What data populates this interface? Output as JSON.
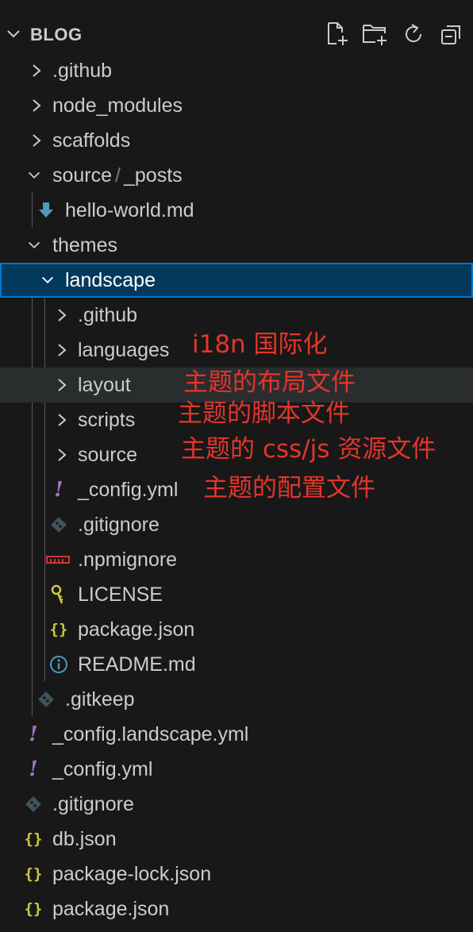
{
  "explorer": {
    "title": "BLOG",
    "actions": [
      {
        "name": "new-file-icon"
      },
      {
        "name": "new-folder-icon"
      },
      {
        "name": "refresh-icon"
      },
      {
        "name": "collapse-all-icon"
      }
    ]
  },
  "tree": [
    {
      "label": ".github",
      "kind": "folder",
      "expanded": false,
      "icon": "chevron-right-icon"
    },
    {
      "label": "node_modules",
      "kind": "folder",
      "expanded": false,
      "icon": "chevron-right-icon"
    },
    {
      "label": "scaffolds",
      "kind": "folder",
      "expanded": false,
      "icon": "chevron-right-icon"
    },
    {
      "label": "source",
      "label_sep": "/",
      "label_tail": "_posts",
      "kind": "folder",
      "expanded": true,
      "icon": "chevron-down-icon"
    },
    {
      "label": "hello-world.md",
      "kind": "file",
      "icon": "markdown-icon"
    },
    {
      "label": "themes",
      "kind": "folder",
      "expanded": true,
      "icon": "chevron-down-icon"
    },
    {
      "label": "landscape",
      "kind": "folder",
      "expanded": true,
      "selected": true,
      "icon": "chevron-down-icon"
    },
    {
      "label": ".github",
      "kind": "folder",
      "expanded": false,
      "icon": "chevron-right-icon"
    },
    {
      "label": "languages",
      "kind": "folder",
      "expanded": false,
      "icon": "chevron-right-icon"
    },
    {
      "label": "layout",
      "kind": "folder",
      "expanded": false,
      "icon": "chevron-right-icon"
    },
    {
      "label": "scripts",
      "kind": "folder",
      "expanded": false,
      "icon": "chevron-right-icon"
    },
    {
      "label": "source",
      "kind": "folder",
      "expanded": false,
      "icon": "chevron-right-icon"
    },
    {
      "label": "_config.yml",
      "kind": "file",
      "icon": "yaml-icon"
    },
    {
      "label": ".gitignore",
      "kind": "file",
      "icon": "git-icon"
    },
    {
      "label": ".npmignore",
      "kind": "file",
      "icon": "npm-icon"
    },
    {
      "label": "LICENSE",
      "kind": "file",
      "icon": "license-key-icon"
    },
    {
      "label": "package.json",
      "kind": "file",
      "icon": "json-icon"
    },
    {
      "label": "README.md",
      "kind": "file",
      "icon": "info-icon"
    },
    {
      "label": ".gitkeep",
      "kind": "file",
      "icon": "git-icon"
    },
    {
      "label": "_config.landscape.yml",
      "kind": "file",
      "icon": "yaml-icon"
    },
    {
      "label": "_config.yml",
      "kind": "file",
      "icon": "yaml-icon"
    },
    {
      "label": ".gitignore",
      "kind": "file",
      "icon": "git-icon"
    },
    {
      "label": "db.json",
      "kind": "file",
      "icon": "json-icon"
    },
    {
      "label": "package-lock.json",
      "kind": "file",
      "icon": "json-icon"
    },
    {
      "label": "package.json",
      "kind": "file",
      "icon": "json-icon"
    }
  ],
  "annotations": {
    "languages": "i18n 国际化",
    "layout": "主题的布局文件",
    "scripts": "主题的脚本文件",
    "source": "主题的 css/js 资源文件",
    "config": "主题的配置文件"
  },
  "glyphs": {
    "yaml": "!",
    "json": "{}"
  },
  "colors": {
    "background": "#181818",
    "selected_bg": "#04395e",
    "selected_border": "#0078d4",
    "hover_bg": "#2a2d2e",
    "text": "#cccccc",
    "annotation": "#e5352b",
    "json_icon": "#cbcb41",
    "yaml_icon": "#a074c4",
    "markdown_icon": "#519aba",
    "git_icon": "#41535b",
    "npm_icon": "#cb3837",
    "license_icon": "#cbcb41",
    "info_icon": "#519aba"
  }
}
